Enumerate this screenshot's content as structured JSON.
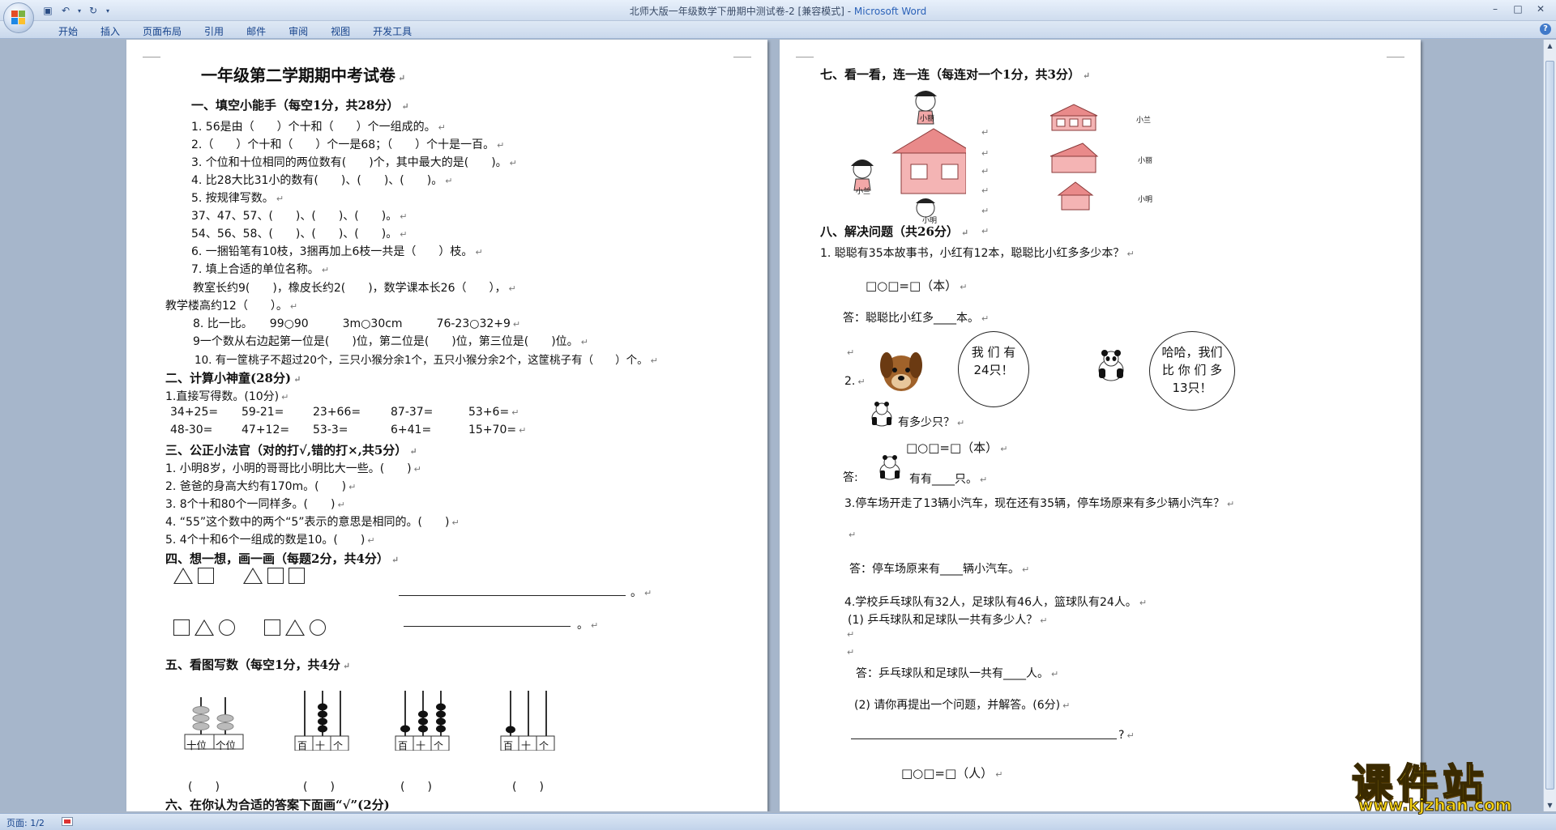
{
  "window": {
    "title": "北师大版一年级数学下册期中测试卷-2 [兼容模式]",
    "app_name": "Microsoft Word"
  },
  "ribbon_tabs": [
    "开始",
    "插入",
    "页面布局",
    "引用",
    "邮件",
    "审阅",
    "视图",
    "开发工具"
  ],
  "status": {
    "page": "页面: 1/2"
  },
  "watermark": {
    "text": "课件站",
    "url": "www.kjzhan.com"
  },
  "left_page": {
    "title": "一年级第二学期期中考试卷",
    "s1": {
      "heading": "一、填空小能手（每空1分，共28分）",
      "lines": [
        "1. 56是由（　　）个十和（　　）个一组成的。",
        "2.（　　）个十和（　　）个一是68；（　　）个十是一百。",
        "3. 个位和十位相同的两位数有(　　)个，其中最大的是(　　)。",
        "4. 比28大比31小的数有(　　)、(　　)、(　　)。",
        "5. 按规律写数。",
        "37、47、57、(　　)、(　　)、(　　)。",
        "54、56、58、(　　)、(　　)、(　　)。",
        "6. 一捆铅笔有10枝，3捆再加上6枝一共是（　　）枝。",
        "7. 填上合适的单位名称。",
        "教室长约9(　　)，橡皮长约2(　　)，数学课本长26（　　），",
        "教学楼高约12（　　）。",
        "8. 比一比。　　99○90　　　3m○30cm　　　76-23○32+9",
        "9一个数从右边起第一位是(　　)位，第二位是(　　)位，第三位是(　　)位。",
        "10. 有一筐桃子不超过20个，三只小猴分余1个，五只小猴分余2个，这筐桃子有（　　）个。"
      ]
    },
    "s2": {
      "heading": "二、计算小神童(28分)",
      "sub": "1.直接写得数。(10分)",
      "row1": [
        "34+25=",
        "59-21=",
        "23+66=",
        "87-37=",
        "53+6="
      ],
      "row2": [
        "48-30=",
        "47+12=",
        "53-3=",
        "6+41=",
        "15+70="
      ]
    },
    "s3": {
      "heading": "三、公正小法官（对的打√,错的打×,共5分）",
      "lines": [
        "1. 小明8岁，小明的哥哥比小明比大一些。(　　)",
        "2. 爸爸的身高大约有170m。(　　)",
        "3. 8个十和80个一同样多。(　　)",
        "4. “55”这个数中的两个“5”表示的意思是相同的。(　　)",
        "5. 4个十和6个一组成的数是10。(　　)"
      ]
    },
    "s4": {
      "heading": "四、想一想，画一画（每题2分，共4分）",
      "end1": "。",
      "end2": "。"
    },
    "s5": {
      "heading": "五、看图写数（每空1分，共4分",
      "a1_labels": [
        "十位",
        "个位"
      ],
      "a_labels": [
        "百",
        "十",
        "个"
      ],
      "answers": [
        "(　　)",
        "(　　)",
        "(　　)",
        "(　　)"
      ]
    },
    "s6": {
      "heading": "六、在你认为合适的答案下面画“√”(2分)"
    }
  },
  "right_page": {
    "s7": {
      "heading": "七、看一看，连一连（每连对一个1分，共3分）",
      "names_left": [
        "小丽",
        "小兰",
        "小明"
      ],
      "names_right": [
        "小兰",
        "小丽",
        "小明"
      ]
    },
    "s8": {
      "heading": "八、解决问题（共26分）",
      "q1": "1. 聪聪有35本故事书，小红有12本，聪聪比小红多多少本？",
      "q1_formula": "□○□=□（本）",
      "q1_answer": "答：聪聪比小红多____本。",
      "q2_num": "2.",
      "bubble1": "我 们 有\n24只！",
      "bubble2": "哈哈，我们\n比 你 们 多\n13只！",
      "q2_ask": "有多少只？",
      "q2_formula": "□○□=□（本）",
      "q2_answer_a": "答:",
      "q2_answer_b": "有有____只。",
      "q3": "3.停车场开走了13辆小汽车，现在还有35辆，停车场原来有多少辆小汽车？",
      "q3_answer": "答：停车场原来有____辆小汽车。",
      "q4": "4.学校乒乓球队有32人，足球队有46人，篮球队有24人。",
      "q4_1": "(1) 乒乓球队和足球队一共有多少人？",
      "q4_1_answer": "答：乒乓球队和足球队一共有____人。",
      "q4_2": "(2) 请你再提出一个问题，并解答。(6分)",
      "q4_2_end": "?",
      "q4_formula": "□○□=□（人）"
    }
  }
}
